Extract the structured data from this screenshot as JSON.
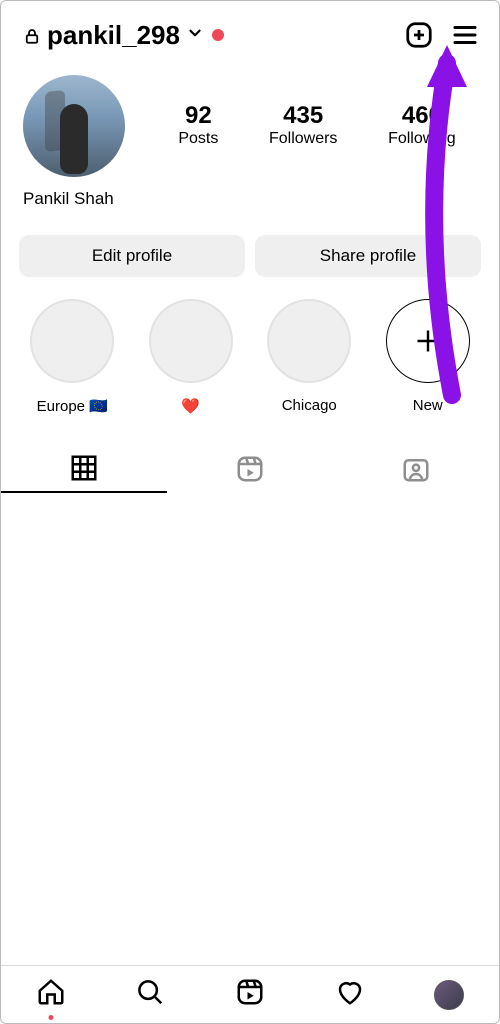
{
  "header": {
    "username": "pankil_298"
  },
  "profile": {
    "display_name": "Pankil Shah"
  },
  "stats": {
    "posts_num": "92",
    "posts_label": "Posts",
    "followers_num": "435",
    "followers_label": "Followers",
    "following_num": "460",
    "following_label": "Following"
  },
  "actions": {
    "edit": "Edit profile",
    "share": "Share profile"
  },
  "highlights": [
    {
      "label": "Europe 🇪🇺"
    },
    {
      "label": "❤️"
    },
    {
      "label": "Chicago"
    },
    {
      "label": "New",
      "isNew": true
    }
  ]
}
